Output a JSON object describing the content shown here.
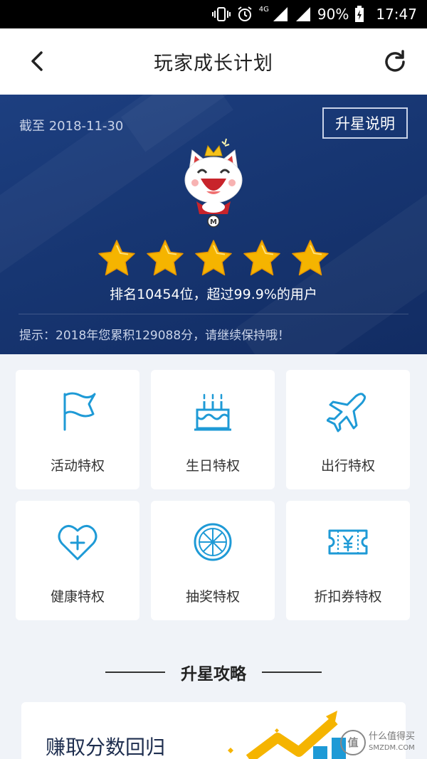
{
  "status_bar": {
    "network": "4G",
    "battery": "90%",
    "time": "17:47",
    "icons": [
      "vibrate-icon",
      "alarm-icon",
      "signal-icon",
      "signal-icon",
      "battery-charging-icon"
    ]
  },
  "header": {
    "title": "玩家成长计划",
    "back_icon": "chevron-left-icon",
    "refresh_icon": "refresh-icon"
  },
  "hero": {
    "date": "截至 2018-11-30",
    "rule_button": "升星说明",
    "stars": 5,
    "rank_text": "排名10454位，超过99.9%的用户",
    "tip": "提示：2018年您累积129088分，请继续保持哦！",
    "star_color": "#f5b400"
  },
  "privileges": [
    {
      "label": "活动特权",
      "icon": "flag-icon"
    },
    {
      "label": "生日特权",
      "icon": "birthday-cake-icon"
    },
    {
      "label": "出行特权",
      "icon": "airplane-icon"
    },
    {
      "label": "健康特权",
      "icon": "heart-plus-icon"
    },
    {
      "label": "抽奖特权",
      "icon": "lottery-wheel-icon"
    },
    {
      "label": "折扣券特权",
      "icon": "coupon-icon"
    }
  ],
  "section": {
    "title": "升星攻略"
  },
  "bottom_card": {
    "title": "赚取分数回归"
  },
  "watermark": {
    "logo": "值",
    "line1": "什么值得买",
    "line2": "SMZDM.COM"
  },
  "colors": {
    "accent": "#1e9ad6",
    "hero_bg": "#173672"
  }
}
